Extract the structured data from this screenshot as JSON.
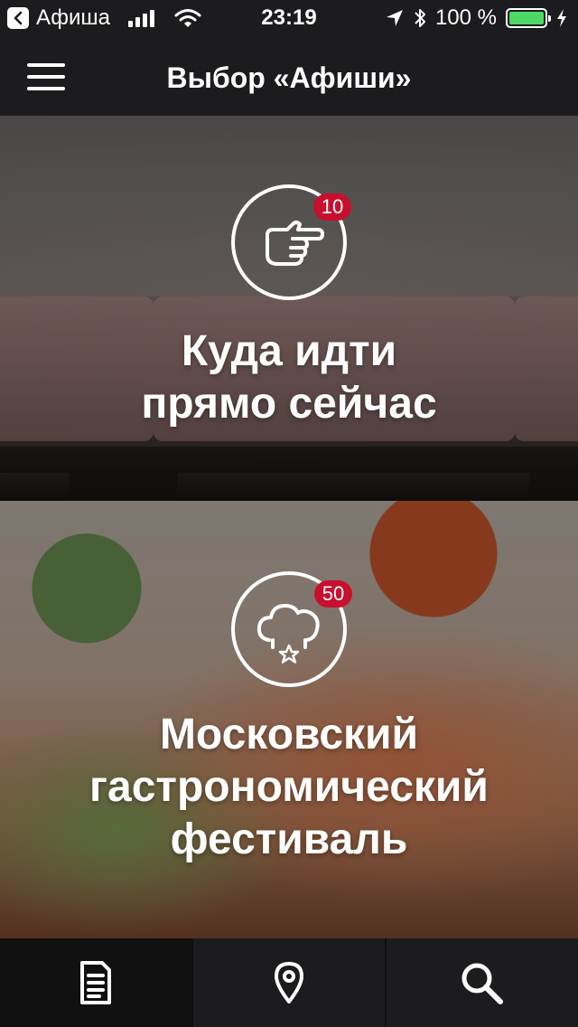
{
  "status_bar": {
    "back_app": "Афиша",
    "time": "23:19",
    "battery_percent": "100 %",
    "battery_level": 1.0
  },
  "header": {
    "title": "Выбор «Афиши»",
    "menu_icon": "hamburger-menu-icon"
  },
  "cards": [
    {
      "icon": "pointing-hand-icon",
      "badge": "10",
      "title_line1": "Куда идти",
      "title_line2": "прямо сейчас"
    },
    {
      "icon": "chef-hat-star-icon",
      "badge": "50",
      "title_line1": "Московский",
      "title_line2": "гастрономический",
      "title_line3": "фестиваль"
    }
  ],
  "tab_bar": {
    "tabs": [
      {
        "icon": "document-icon",
        "active": true
      },
      {
        "icon": "location-pin-icon",
        "active": false
      },
      {
        "icon": "search-icon",
        "active": false
      }
    ]
  },
  "colors": {
    "badge": "#c8102e",
    "battery": "#4cd964",
    "bar_background": "#1c1c1e"
  }
}
